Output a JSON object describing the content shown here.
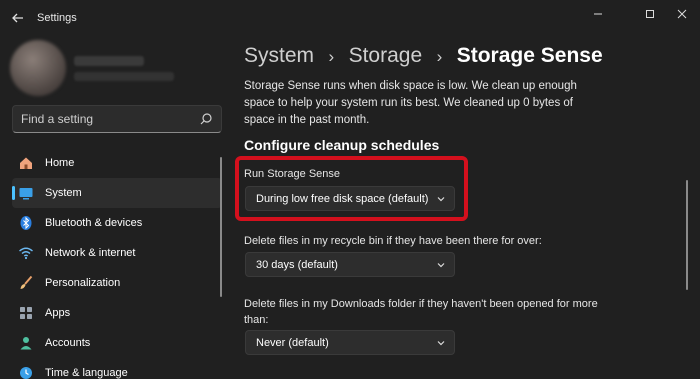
{
  "window": {
    "title": "Settings"
  },
  "search": {
    "placeholder": "Find a setting"
  },
  "sidebar": {
    "items": [
      {
        "label": "Home",
        "icon": "home-icon",
        "active": false
      },
      {
        "label": "System",
        "icon": "system-icon",
        "active": true
      },
      {
        "label": "Bluetooth & devices",
        "icon": "bluetooth-icon",
        "active": false
      },
      {
        "label": "Network & internet",
        "icon": "wifi-icon",
        "active": false
      },
      {
        "label": "Personalization",
        "icon": "brush-icon",
        "active": false
      },
      {
        "label": "Apps",
        "icon": "apps-icon",
        "active": false
      },
      {
        "label": "Accounts",
        "icon": "account-icon",
        "active": false
      },
      {
        "label": "Time & language",
        "icon": "clock-icon",
        "active": false
      }
    ]
  },
  "breadcrumb": {
    "items": [
      "System",
      "Storage"
    ],
    "current": "Storage Sense"
  },
  "main": {
    "description": "Storage Sense runs when disk space is low. We clean up enough space to help your system run its best. We cleaned up 0 bytes of space in the past month.",
    "section_heading": "Configure cleanup schedules",
    "settings": [
      {
        "label": "Run Storage Sense",
        "value": "During low free disk space (default)"
      },
      {
        "label": "Delete files in my recycle bin if they have been there for over:",
        "value": "30 days (default)"
      },
      {
        "label": "Delete files in my Downloads folder if they haven't been opened for more than:",
        "value": "Never (default)"
      }
    ]
  },
  "colors": {
    "accent": "#4cc2ff",
    "highlight": "#d4101d",
    "background": "#202020"
  }
}
